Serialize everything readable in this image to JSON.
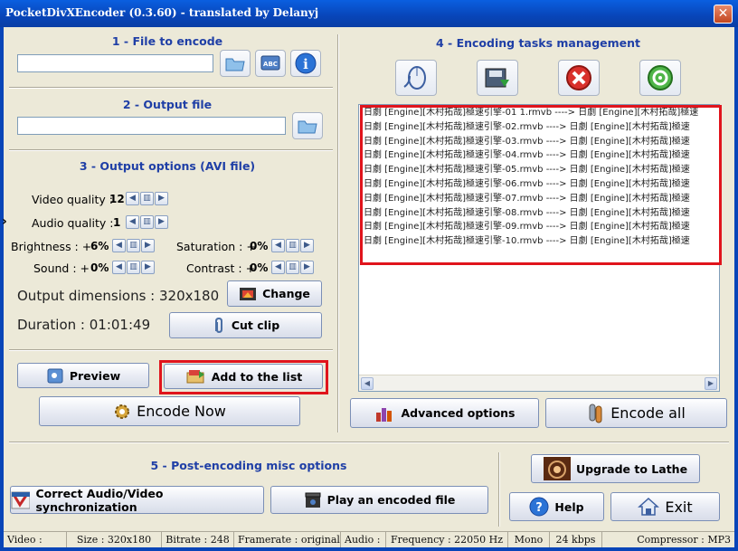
{
  "window": {
    "title": "PocketDivXEncoder (0.3.60) - translated by Delanyj",
    "close_glyph": "✕"
  },
  "file_section": {
    "title": "1 - File to encode",
    "input_value": "",
    "icons": [
      "open-folder-icon",
      "abc-rename-icon",
      "info-icon"
    ]
  },
  "output_section": {
    "title": "2 - Output file",
    "input_value": ""
  },
  "options_section": {
    "title": "3 - Output options (AVI file)",
    "video_quality_label": "Video quality :",
    "video_quality_value": "12",
    "audio_quality_label": "Audio quality :",
    "audio_quality_value": "1",
    "brightness_label": "Brightness : +",
    "brightness_value": "6%",
    "saturation_label": "Saturation : +",
    "saturation_value": "0%",
    "sound_label": "Sound : +",
    "sound_value": "0%",
    "contrast_label": "Contrast : +",
    "contrast_value": "0%",
    "dimensions_label": "Output dimensions : 320x180",
    "change_button": "Change",
    "duration_label": "Duration : 01:01:49",
    "cut_clip_button": "Cut clip",
    "expand_arrow": "›"
  },
  "actions": {
    "preview_button": "Preview",
    "add_to_list_button": "Add to the list",
    "encode_now_button": "Encode Now"
  },
  "tasks_section": {
    "title": "4 - Encoding tasks management",
    "rows": [
      "日劇 [Engine][木村拓哉]極速引擎-01 1.rmvb  ---->  日劇 [Engine][木村拓哉]極速",
      "日劇 [Engine][木村拓哉]極速引擎-02.rmvb  ---->  日劇 [Engine][木村拓哉]極速",
      "日劇 [Engine][木村拓哉]極速引擎-03.rmvb  ---->  日劇 [Engine][木村拓哉]極速",
      "日劇 [Engine][木村拓哉]極速引擎-04.rmvb  ---->  日劇 [Engine][木村拓哉]極速",
      "日劇 [Engine][木村拓哉]極速引擎-05.rmvb  ---->  日劇 [Engine][木村拓哉]極速",
      "日劇 [Engine][木村拓哉]極速引擎-06.rmvb  ---->  日劇 [Engine][木村拓哉]極速",
      "日劇 [Engine][木村拓哉]極速引擎-07.rmvb  ---->  日劇 [Engine][木村拓哉]極速",
      "日劇 [Engine][木村拓哉]極速引擎-08.rmvb  ---->  日劇 [Engine][木村拓哉]極速",
      "日劇 [Engine][木村拓哉]極速引擎-09.rmvb  ---->  日劇 [Engine][木村拓哉]極速",
      "日劇 [Engine][木村拓哉]極速引擎-10.rmvb  ---->  日劇 [Engine][木村拓哉]極速"
    ],
    "advanced_options_button": "Advanced options",
    "encode_all_button": "Encode all"
  },
  "post_section": {
    "title": "5 - Post-encoding misc options",
    "correct_sync_button": "Correct Audio/Video synchronization",
    "play_encoded_button": "Play an encoded file"
  },
  "side_buttons": {
    "upgrade_button": "Upgrade to Lathe",
    "help_button": "Help",
    "exit_button": "Exit"
  },
  "status": {
    "video": "Video :",
    "size": "Size : 320x180",
    "bitrate": "Bitrate : 248",
    "framerate": "Framerate : original",
    "audio": "Audio :",
    "frequency": "Frequency : 22050 Hz",
    "channels": "Mono",
    "kbps": "24 kbps",
    "compressor": "Compressor : MP3"
  },
  "colors": {
    "accent": "#1f3fa6",
    "highlight": "#e0141c",
    "titlebar": "#0845b8"
  }
}
